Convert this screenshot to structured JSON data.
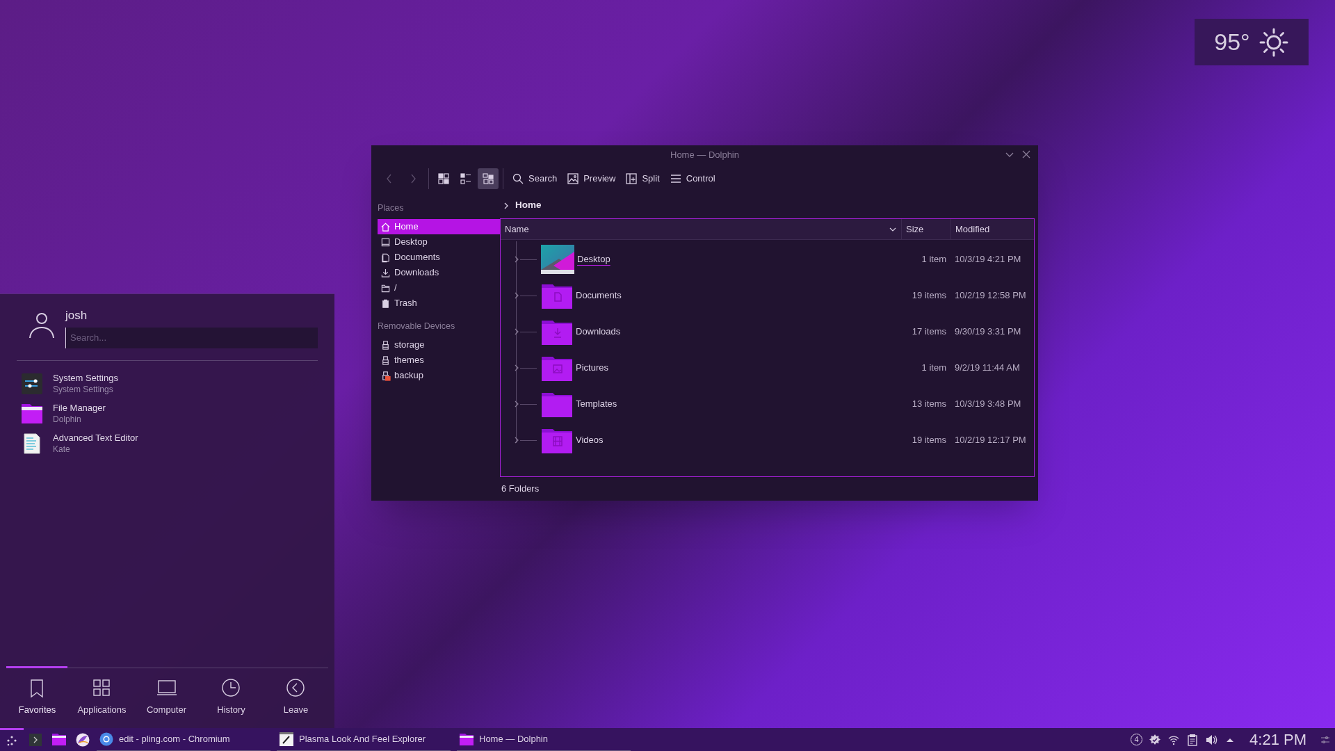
{
  "weather": {
    "temperature": "95°"
  },
  "dolphin": {
    "title": "Home — Dolphin",
    "nav": [
      {
        "kind": "back",
        "disabled": true
      },
      {
        "kind": "forward",
        "disabled": true
      }
    ],
    "view_modes": [
      {
        "kind": "icons",
        "selected": false
      },
      {
        "kind": "compact",
        "selected": false
      },
      {
        "kind": "details",
        "selected": true
      }
    ],
    "actions": [
      {
        "kind": "search",
        "label": "Search"
      },
      {
        "kind": "preview",
        "label": "Preview"
      },
      {
        "kind": "split",
        "label": "Split"
      },
      {
        "kind": "control",
        "label": "Control"
      }
    ],
    "places": [
      {
        "heading": "Places",
        "items": [
          {
            "kind": "home",
            "label": "Home",
            "selected": true
          },
          {
            "kind": "desktop",
            "label": "Desktop",
            "selected": false
          },
          {
            "kind": "documents",
            "label": "Documents",
            "selected": false
          },
          {
            "kind": "downloads",
            "label": "Downloads",
            "selected": false
          },
          {
            "kind": "folder",
            "label": "/",
            "selected": false
          },
          {
            "kind": "trash",
            "label": "Trash",
            "selected": false
          }
        ]
      },
      {
        "heading": "Removable Devices",
        "items": [
          {
            "kind": "drive",
            "label": "storage",
            "selected": false
          },
          {
            "kind": "drive",
            "label": "themes",
            "selected": false
          },
          {
            "kind": "drive-error",
            "label": "backup",
            "selected": false
          }
        ]
      }
    ],
    "breadcrumb": "Home",
    "columns": [
      "Name",
      "Size",
      "Modified"
    ],
    "rows": [
      {
        "kind": "preview",
        "name": "Desktop",
        "size": "1 item",
        "modified": "10/3/19 4:21 PM",
        "hovered": true
      },
      {
        "kind": "documents",
        "name": "Documents",
        "size": "19 items",
        "modified": "10/2/19 12:58 PM",
        "hovered": false
      },
      {
        "kind": "downloads",
        "name": "Downloads",
        "size": "17 items",
        "modified": "9/30/19 3:31 PM",
        "hovered": false
      },
      {
        "kind": "pictures",
        "name": "Pictures",
        "size": "1 item",
        "modified": "9/2/19 11:44 AM",
        "hovered": false
      },
      {
        "kind": "plain",
        "name": "Templates",
        "size": "13 items",
        "modified": "10/3/19 3:48 PM",
        "hovered": false
      },
      {
        "kind": "videos",
        "name": "Videos",
        "size": "19 items",
        "modified": "10/2/19 12:17 PM",
        "hovered": false
      }
    ],
    "status_bar": "6 Folders"
  },
  "launcher": {
    "user": "josh",
    "search": {
      "placeholder": "Search..."
    },
    "apps": [
      {
        "kind": "settings",
        "title": "System Settings",
        "subtitle": "System Settings"
      },
      {
        "kind": "folder",
        "title": "File Manager",
        "subtitle": "Dolphin"
      },
      {
        "kind": "text-editor",
        "title": "Advanced Text Editor",
        "subtitle": "Kate"
      }
    ],
    "tabs": [
      {
        "kind": "bookmark",
        "label": "Favorites",
        "selected": true
      },
      {
        "kind": "grid",
        "label": "Applications",
        "selected": false
      },
      {
        "kind": "laptop",
        "label": "Computer",
        "selected": false
      },
      {
        "kind": "clock",
        "label": "History",
        "selected": false
      },
      {
        "kind": "leave",
        "label": "Leave",
        "selected": false
      }
    ]
  },
  "taskbar": {
    "launchers": [
      {
        "kind": "menu"
      },
      {
        "kind": "terminal"
      },
      {
        "kind": "folder"
      },
      {
        "kind": "bird"
      }
    ],
    "tasks": [
      {
        "kind": "browser",
        "label": "edit - pling.com - Chromium"
      },
      {
        "kind": "pen",
        "label": "Plasma Look And Feel Explorer"
      },
      {
        "kind": "folder",
        "label": "Home — Dolphin"
      }
    ],
    "notifications": "4",
    "clock": "4:21 PM"
  }
}
